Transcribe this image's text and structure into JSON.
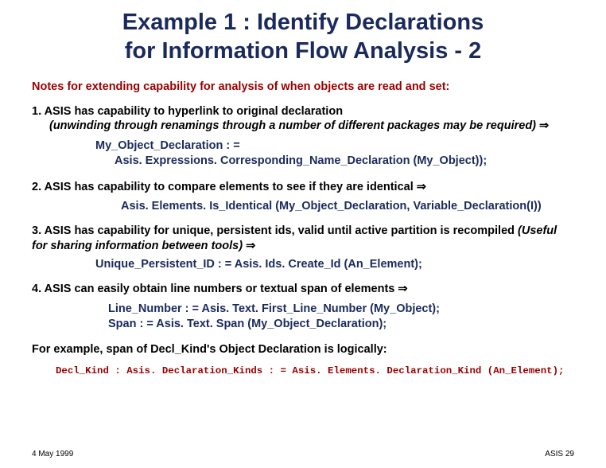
{
  "title_line1": "Example 1 : Identify Declarations",
  "title_line2": "for Information Flow Analysis - 2",
  "subtitle": "Notes for extending capability for analysis of when objects are read and set:",
  "items": {
    "i1": {
      "lead": "1. ASIS has capability to hyperlink to original declaration ",
      "italic": "(unwinding through renamings through a number of different packages may be required) ",
      "arrow": "⇒",
      "code_l1": "My_Object_Declaration : =",
      "code_l2": "Asis. Expressions. Corresponding_Name_Declaration (My_Object));"
    },
    "i2": {
      "lead": "2.  ASIS has capability to compare elements to see if they are identical ",
      "arrow": "⇒",
      "code": "Asis. Elements. Is_Identical (My_Object_Declaration, Variable_Declaration(I))"
    },
    "i3": {
      "lead": "3.  ASIS has capability for unique, persistent ids, valid until active partition is recompiled ",
      "italic": "(Useful for sharing information between tools) ",
      "arrow": "⇒",
      "code": "Unique_Persistent_ID : = Asis. Ids. Create_Id (An_Element);"
    },
    "i4": {
      "lead": "4.  ASIS can easily obtain line numbers or textual span of elements ",
      "arrow": "⇒",
      "code_l1": " Line_Number : = Asis. Text. First_Line_Number (My_Object);",
      "code_l2": "Span : = Asis. Text. Span (My_Object_Declaration);"
    }
  },
  "for_example": "For example, span of Decl_Kind's Object Declaration is logically:",
  "red_code": "Decl_Kind : Asis. Declaration_Kinds : = Asis. Elements. Declaration_Kind (An_Element);",
  "footer": {
    "left": "4 May 1999",
    "right": "ASIS 29"
  }
}
